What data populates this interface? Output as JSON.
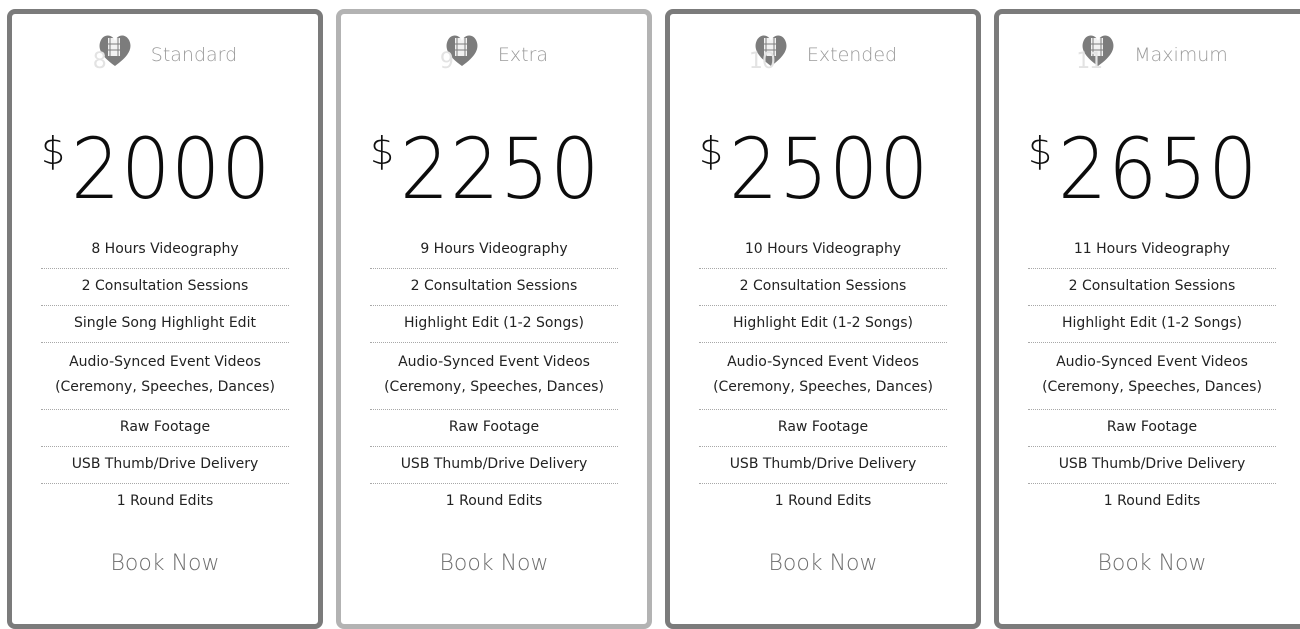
{
  "plans": [
    {
      "name": "Standard",
      "badge_number": "8",
      "icon": "heart-filmstrip-icon",
      "currency": "$",
      "amount": "2000",
      "features": [
        "8 Hours Videography",
        "2 Consultation Sessions",
        "Single Song Highlight Edit",
        "Audio-Synced Event Videos (Ceremony, Speeches, Dances)",
        "Raw Footage",
        "USB Thumb/Drive Delivery",
        "1 Round Edits"
      ],
      "cta": "Book Now"
    },
    {
      "name": "Extra",
      "badge_number": "9",
      "icon": "heart-filmstrip-icon",
      "currency": "$",
      "amount": "2250",
      "features": [
        "9 Hours Videography",
        "2 Consultation Sessions",
        "Highlight Edit (1-2 Songs)",
        "Audio-Synced Event Videos (Ceremony, Speeches, Dances)",
        "Raw Footage",
        "USB Thumb/Drive Delivery",
        "1 Round Edits"
      ],
      "cta": "Book Now"
    },
    {
      "name": "Extended",
      "badge_number": "10",
      "icon": "heart-filmstrip-icon",
      "currency": "$",
      "amount": "2500",
      "features": [
        "10 Hours Videography",
        "2 Consultation Sessions",
        "Highlight Edit (1-2 Songs)",
        "Audio-Synced Event Videos (Ceremony, Speeches, Dances)",
        "Raw Footage",
        "USB Thumb/Drive Delivery",
        "1 Round Edits"
      ],
      "cta": "Book Now"
    },
    {
      "name": "Maximum",
      "badge_number": "11",
      "icon": "heart-filmstrip-icon",
      "currency": "$",
      "amount": "2650",
      "features": [
        "11 Hours Videography",
        "2 Consultation Sessions",
        "Highlight Edit (1-2 Songs)",
        "Audio-Synced Event Videos (Ceremony, Speeches, Dances)",
        "Raw Footage",
        "USB Thumb/Drive Delivery",
        "1 Round Edits"
      ],
      "cta": "Book Now"
    }
  ],
  "colors": {
    "border_dark": "#7b7b7b",
    "border_light": "#b3b3b3",
    "plan_name": "#9a9a9a",
    "cta": "#6e6e6e",
    "text": "#222222"
  }
}
